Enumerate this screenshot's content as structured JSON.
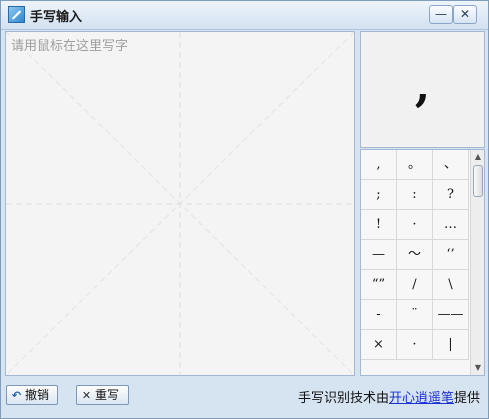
{
  "window": {
    "title": "手写输入",
    "minimize_glyph": "—",
    "close_glyph": "✕"
  },
  "canvas": {
    "hint": "请用鼠标在这里写字"
  },
  "preview": {
    "char": ","
  },
  "candidates": [
    ",",
    "。",
    "、",
    ";",
    ":",
    "?",
    "!",
    "·",
    "…",
    "—",
    "～",
    "‘’",
    "“”",
    "/",
    "\\",
    "-",
    "¨",
    "——",
    "×",
    "·",
    "|"
  ],
  "scrollbar": {
    "up_glyph": "▲",
    "down_glyph": "▼"
  },
  "bottom": {
    "undo_label": "撤销",
    "undo_icon_glyph": "↶",
    "redo_label": "重写",
    "redo_icon_glyph": "✕",
    "credit_prefix": "手写识别技术由",
    "credit_link": "开心逍遥笔",
    "credit_suffix": "提供"
  },
  "colors": {
    "accent": "#1d5fb3",
    "link": "#1a2fd6",
    "frame": "#d6e3f1"
  }
}
